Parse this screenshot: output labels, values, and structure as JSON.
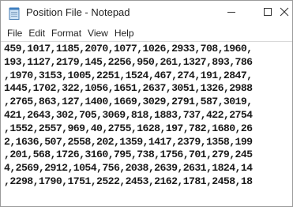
{
  "window": {
    "title": "Position File - Notepad",
    "app_icon": "notepad-icon",
    "controls": {
      "minimize_icon": "minimize-icon",
      "maximize_icon": "maximize-icon",
      "close_icon": "close-icon"
    }
  },
  "menu": {
    "items": [
      "File",
      "Edit",
      "Format",
      "View",
      "Help"
    ]
  },
  "editor": {
    "lines": [
      "459,1017,1185,2070,1077,1026,2933,708,1960,",
      "193,1127,2179,145,2256,950,261,1327,893,786",
      ",1970,3153,1005,2251,1524,467,274,191,2847,",
      "1445,1702,322,1056,1651,2637,3051,1326,2988",
      ",2765,863,127,1400,1669,3029,2791,587,3019,",
      "421,2643,302,705,3069,818,1883,737,422,2754",
      ",1552,2557,969,40,2755,1628,197,782,1680,26",
      "2,1636,507,2558,202,1359,1417,2379,1358,199",
      ",201,568,1726,3160,795,738,1756,701,279,245",
      "4,2569,2912,1054,756,2038,2639,2631,1824,14",
      ",2298,1790,1751,2522,2453,2162,1781,2458,18"
    ]
  }
}
